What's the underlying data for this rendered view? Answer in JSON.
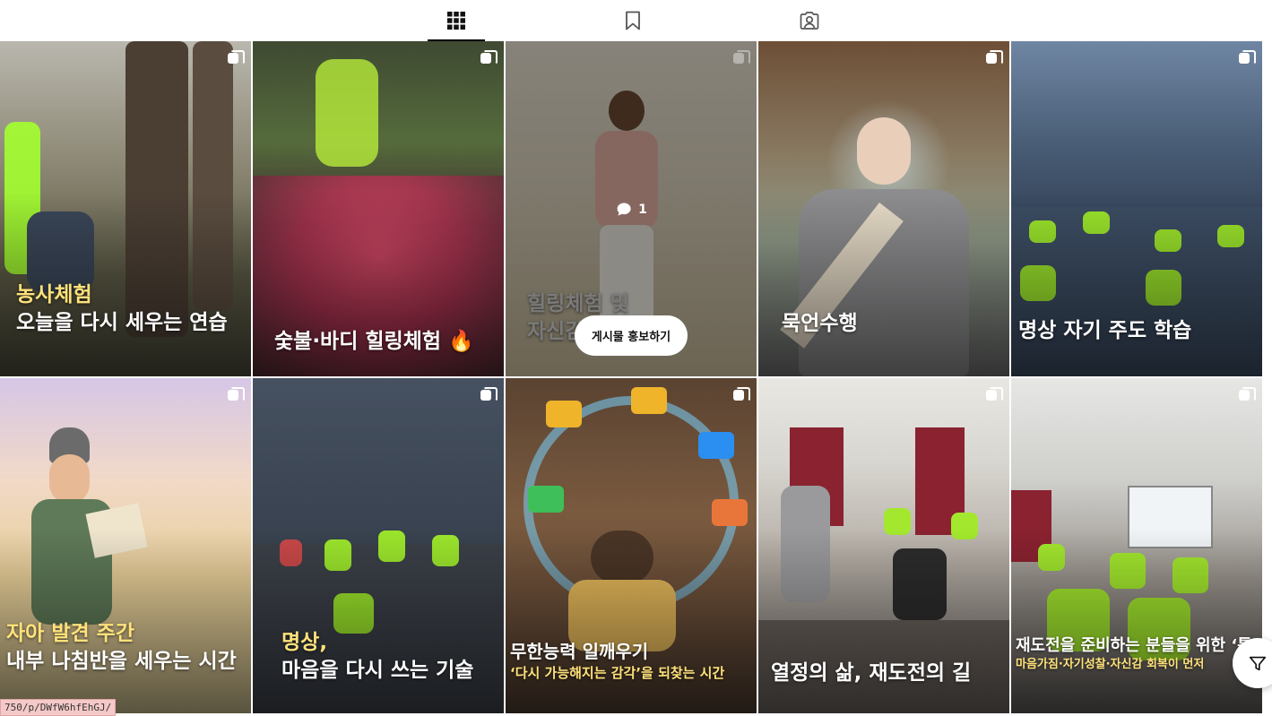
{
  "tabs": [
    {
      "name": "posts",
      "icon": "grid-icon",
      "active": true
    },
    {
      "name": "saved",
      "icon": "bookmark-icon",
      "active": false
    },
    {
      "name": "tagged",
      "icon": "tagged-person-icon",
      "active": false
    }
  ],
  "posts": [
    {
      "line1": "농사체험",
      "line2": "오늘을 다시 세우는 연습"
    },
    {
      "line1": "숯불·바디 힐링체험 🔥"
    },
    {
      "line1": "힐링체험 및",
      "line2": "자신감",
      "comment_count": "1",
      "promote_label": "게시물 홍보하기"
    },
    {
      "line1": "묵언수행"
    },
    {
      "line1": "명상 자기 주도 학습"
    },
    {
      "line1": "자아 발견 주간",
      "line2": "내부 나침반을 세우는 시간"
    },
    {
      "line1": "명상,",
      "line2": "마음을 다시 쓰는 기술"
    },
    {
      "line1": "무한능력 일깨우기",
      "line2": "‘다시 가능해지는 감각’을 되찾는 시간"
    },
    {
      "line1": "열정의 삶, 재도전의 길"
    },
    {
      "line1": "재도전을 준비하는 분들을 위한 ‘특",
      "line2": "마음가짐·자기성찰·자신감 회복이 먼저"
    }
  ],
  "status_url": "750/p/DWfW6hfEhGJ/",
  "colors": {
    "highlight_yellow": "#ffe27a",
    "tab_active": "#000000",
    "url_tip_bg": "#f5c9c9"
  }
}
